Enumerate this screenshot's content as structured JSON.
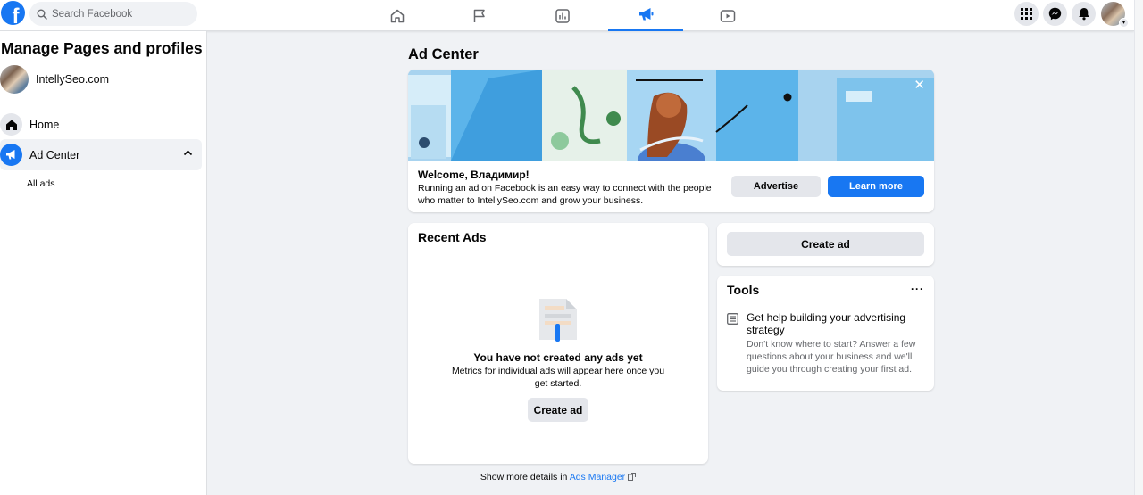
{
  "topbar": {
    "logo_letter": "f",
    "search_placeholder": "Search Facebook",
    "nav": [
      "home-icon",
      "pages-flag-icon",
      "insights-icon",
      "ad-center-megaphone-icon",
      "watch-video-icon"
    ],
    "active_nav": 3,
    "right_icons": [
      "menu-grid-icon",
      "messenger-icon",
      "notifications-bell-icon",
      "account-avatar"
    ]
  },
  "sidebar": {
    "title": "Manage Pages and profiles",
    "page_name": "IntellySeo.com",
    "items": [
      {
        "label": "Home",
        "icon": "home-icon"
      },
      {
        "label": "Ad Center",
        "icon": "megaphone-icon"
      }
    ],
    "sub_items": [
      {
        "label": "All ads"
      }
    ]
  },
  "main": {
    "title": "Ad Center",
    "welcome": {
      "title": "Welcome, Владимир!",
      "desc": "Running an ad on Facebook is an easy way to connect with the people who matter to IntellySeo.com and grow your business.",
      "advertise_label": "Advertise",
      "learn_more_label": "Learn more",
      "close_icon": "close-icon"
    },
    "recent_ads": {
      "title": "Recent Ads",
      "empty_title": "You have not created any ads yet",
      "empty_desc": "Metrics for individual ads will appear here once you get started.",
      "create_label": "Create ad"
    },
    "create_card": {
      "create_label": "Create ad"
    },
    "tools": {
      "title": "Tools",
      "more_label": "···",
      "tip_title": "Get help building your advertising strategy",
      "tip_desc": "Don't know where to start? Answer a few questions about your business and we'll guide you through creating your first ad."
    },
    "footer": {
      "prefix": "Show more details in",
      "link": "Ads Manager"
    }
  },
  "colors": {
    "brand_blue": "#1877f2",
    "page_bg": "#f0f2f5",
    "button_grey": "#e4e6eb",
    "banner_blue": "#a8d3ef"
  }
}
